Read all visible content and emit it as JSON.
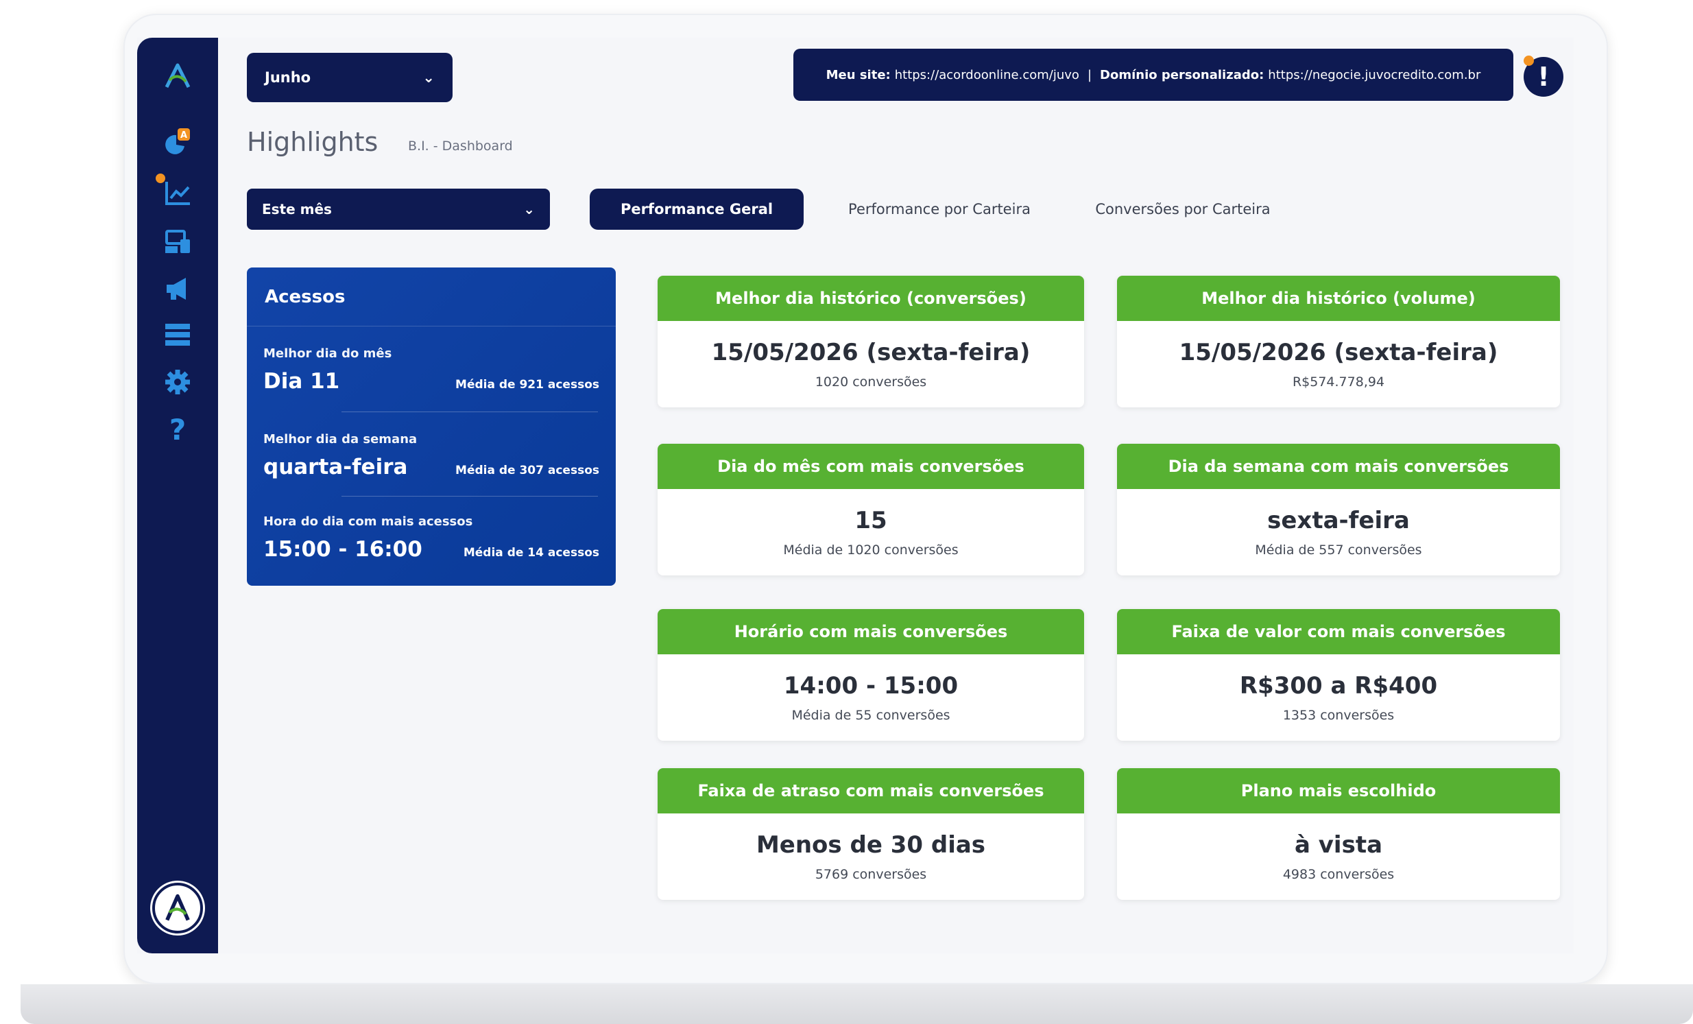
{
  "header": {
    "month_select": "Junho",
    "site_label": "Meu site:",
    "site_url": "https://acordoonline.com/juvo",
    "separator": "|",
    "domain_label": "Domínio personalizado:",
    "domain_url": "https://negocie.juvocredito.com.br",
    "alert_symbol": "!"
  },
  "page": {
    "title": "Highlights",
    "breadcrumb": "B.I. - Dashboard"
  },
  "filters": {
    "period_select": "Este mês",
    "tabs": [
      {
        "label": "Performance Geral",
        "active": true
      },
      {
        "label": "Performance por Carteira",
        "active": false
      },
      {
        "label": "Conversões por Carteira",
        "active": false
      }
    ]
  },
  "acessos": {
    "title": "Acessos",
    "rows": [
      {
        "label": "Melhor dia do mês",
        "value": "Dia 11",
        "sub": "Média de 921 acessos"
      },
      {
        "label": "Melhor dia da semana",
        "value": "quarta-feira",
        "sub": "Média de 307 acessos"
      },
      {
        "label": "Hora do dia com mais acessos",
        "value": "15:00 - 16:00",
        "sub": "Média de 14 acessos"
      }
    ]
  },
  "cards": [
    {
      "title": "Melhor dia histórico (conversões)",
      "value": "15/05/2026 (sexta-feira)",
      "sub": "1020 conversões"
    },
    {
      "title": "Melhor dia histórico (volume)",
      "value": "15/05/2026 (sexta-feira)",
      "sub": "R$574.778,94"
    },
    {
      "title": "Dia do mês com mais conversões",
      "value": "15",
      "sub": "Média de 1020 conversões"
    },
    {
      "title": "Dia da semana com mais conversões",
      "value": "sexta-feira",
      "sub": "Média de 557 conversões"
    },
    {
      "title": "Horário com mais conversões",
      "value": "14:00 - 15:00",
      "sub": "Média de 55 conversões"
    },
    {
      "title": "Faixa de valor com mais conversões",
      "value": "R$300 a R$400",
      "sub": "1353 conversões"
    },
    {
      "title": "Faixa de atraso com mais conversões",
      "value": "Menos de 30 dias",
      "sub": "5769 conversões"
    },
    {
      "title": "Plano mais escolhido",
      "value": "à vista",
      "sub": "4983 conversões"
    }
  ],
  "sidebar": {
    "icons": [
      "logo-icon",
      "dashboard-pie-icon",
      "chart-line-icon",
      "devices-icon",
      "megaphone-icon",
      "list-icon",
      "gear-icon",
      "help-icon"
    ]
  },
  "colors": {
    "navy": "#0e1a52",
    "blue_panel": "#1244a8",
    "green_header": "#57b132",
    "orange_badge": "#f39322"
  }
}
